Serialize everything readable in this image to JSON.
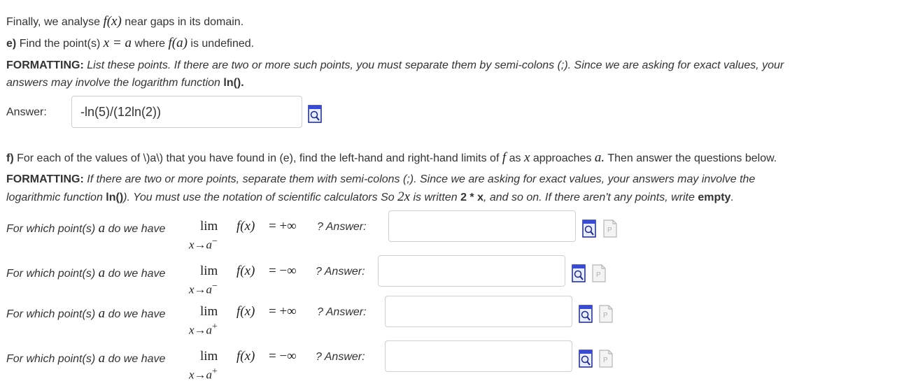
{
  "intro": {
    "text_before": "Finally, we analyse",
    "fx": "f(x)",
    "text_after": "near gaps in its domain."
  },
  "part_e": {
    "label": "e)",
    "text1": "Find the point(s)",
    "eq": "x = a",
    "text2": "where",
    "fa": "f(a)",
    "text3": "is undefined.",
    "formatting_label": "FORMATTING:",
    "formatting_line1": "List these points. If there are two or more such points, you must separate them by semi-colons (;). Since we are asking for exact values, your",
    "formatting_line2": "answers may involve the logarithm function",
    "ln_label": "ln().",
    "answer_label": "Answer:",
    "answer_value": "-ln(5)/(12ln(2))"
  },
  "part_f": {
    "label": "f)",
    "text1": "For each of the values of \\)a\\) that you have found in (e), find the left-hand and right-hand limits of",
    "f": "f",
    "text2": "as",
    "x": "x",
    "text3": "approaches",
    "a": "a.",
    "text4": "Then answer the questions below.",
    "formatting_label": "FORMATTING:",
    "formatting_line1": "If there are two or more points, separate them with semi-colons (;). Since we are asking for exact values, your answers may involve the",
    "formatting_line2a": "logarithmic function",
    "ln_label": "ln()",
    "formatting_line2b": "). You must use the notation of scientific calculators   So",
    "two_x": "2x",
    "formatting_line2c": "is written",
    "two_star_x": "2 * x",
    "formatting_line2d": ", and so on.   If there aren't any points, write",
    "empty_word": "empty",
    "period": "."
  },
  "questions": [
    {
      "prefix": "For which point(s)",
      "a": "a",
      "mid": "do we have",
      "lim": "lim",
      "sub": "x→a",
      "sup": "−",
      "fx": "f(x)",
      "eq": "= +∞",
      "suffix": "? Answer:",
      "value": ""
    },
    {
      "prefix": "For which point(s)",
      "a": "a",
      "mid": "do we have",
      "lim": "lim",
      "sub": "x→a",
      "sup": "−",
      "fx": "f(x)",
      "eq": "= −∞",
      "suffix": "? Answer:",
      "value": ""
    },
    {
      "prefix": "For which point(s)",
      "a": "a",
      "mid": "do we have",
      "lim": "lim",
      "sub": "x→a",
      "sup": "+",
      "fx": "f(x)",
      "eq": "= +∞",
      "suffix": "? Answer:",
      "value": ""
    },
    {
      "prefix": "For which point(s)",
      "a": "a",
      "mid": "do we have",
      "lim": "lim",
      "sub": "x→a",
      "sup": "+",
      "fx": "f(x)",
      "eq": "= −∞",
      "suffix": "? Answer:",
      "value": ""
    }
  ],
  "icons": {
    "preview": "preview-icon",
    "pdf": "pdf-icon"
  }
}
